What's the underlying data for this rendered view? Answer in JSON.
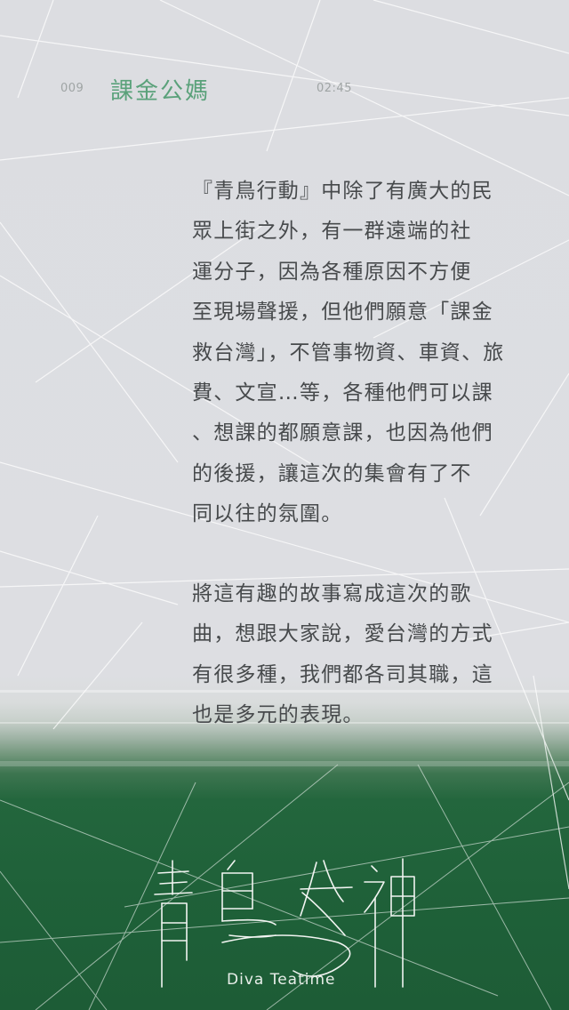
{
  "header": {
    "number": "009",
    "title": "課金公媽",
    "time": "02:45"
  },
  "paragraph1": [
    "『青鳥行動』中除了有廣大的民",
    "眾上街之外，有一群遠端的社",
    "運分子，因為各種原因不方便",
    "至現場聲援，但他們願意「課金",
    "救台灣」，不管事物資、車資、旅",
    "費、文宣…等，各種他們可以課",
    "、想課的都願意課，也因為他們",
    "的後援，讓這次的集會有了不",
    "同以往的氛圍。"
  ],
  "paragraph2": [
    "將這有趣的故事寫成這次的歌",
    "曲，想跟大家說，愛台灣的方式",
    "有很多種，我們都各司其職，這",
    "也是多元的表現。"
  ],
  "logo": {
    "title": "青鳥女神",
    "subtitle": "Diva Teatime"
  },
  "colors": {
    "background_top": "#dcdde1",
    "background_bottom": "#1f6139",
    "title_green": "#5aa17a",
    "body_text": "#474a4c"
  }
}
